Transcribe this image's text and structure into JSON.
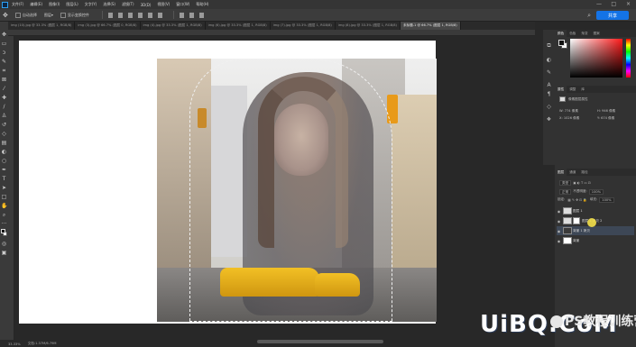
{
  "menubar": {
    "items": [
      "文件(F)",
      "编辑(E)",
      "图像(I)",
      "图层(L)",
      "文字(Y)",
      "选择(S)",
      "滤镜(T)",
      "3D(D)",
      "视图(V)",
      "窗口(W)",
      "帮助(H)"
    ],
    "window_controls": [
      "—",
      "□",
      "×"
    ]
  },
  "optionsbar": {
    "auto_select": "自动选择",
    "layer": "图层",
    "show_transform": "显示变换控件",
    "share_label": "共享"
  },
  "tabs": [
    "img (10).jpg @ 33.3% (图层 1, RGB/8)",
    "img (3).jpg @ 66.7% (图层 0, RGB/8)",
    "img (4).jpg @ 33.3% (图层 1, RGB/8)",
    "img (6).jpg @ 33.3% (图层 1, RGB/8)",
    "img (7).jpg @ 33.3% (图层 1, RGB/8)",
    "img (8).jpg @ 33.3% (图层 1, RGB/8)",
    "未标题-1 @ 66.7% (图层 1, RGB/8)"
  ],
  "status": {
    "zoom": "33.33%",
    "doc_size": "文档:1.37M/6.79M"
  },
  "colors": {
    "accent": "#1473e6",
    "selection": "#3d4756",
    "background": "#282828"
  },
  "color_panel": {
    "tabs": [
      "颜色",
      "色板",
      "渐变",
      "图案"
    ]
  },
  "props_panel": {
    "tabs": [
      "属性",
      "调整",
      "库"
    ],
    "kind": "像素图层属性",
    "w_label": "W:",
    "w_val": "774 像素",
    "h_label": "H:",
    "h_val": "946 像素",
    "x_label": "X:",
    "x_val": "1026 像素",
    "y_label": "Y:",
    "y_val": "674 像素"
  },
  "layers_panel": {
    "tabs": [
      "图层",
      "通道",
      "路径"
    ],
    "filter": "类型",
    "blend_mode": "正常",
    "opacity_label": "不透明度:",
    "opacity_val": "100%",
    "lock_label": "锁定:",
    "fill_label": "填充:",
    "fill_val": "100%",
    "layers": [
      {
        "name": "图层 1",
        "selected": false
      },
      {
        "name": "图层 1 拷贝 2",
        "selected": false
      },
      {
        "name": "背景 1 拷贝",
        "selected": true
      },
      {
        "name": "背景",
        "selected": false
      }
    ]
  },
  "watermark": {
    "logo": "UiBQ.CoM",
    "brand": "PS教程训练营"
  }
}
